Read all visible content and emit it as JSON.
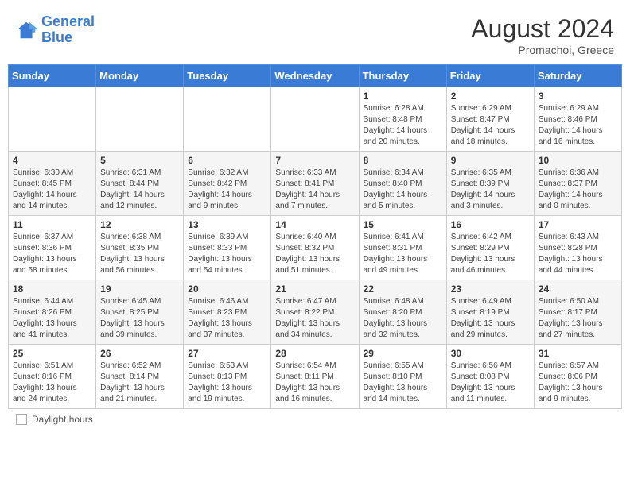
{
  "header": {
    "logo_line1": "General",
    "logo_line2": "Blue",
    "month_year": "August 2024",
    "location": "Promachoi, Greece"
  },
  "columns": [
    "Sunday",
    "Monday",
    "Tuesday",
    "Wednesday",
    "Thursday",
    "Friday",
    "Saturday"
  ],
  "legend": {
    "label": "Daylight hours"
  },
  "weeks": [
    [
      {
        "day": "",
        "info": ""
      },
      {
        "day": "",
        "info": ""
      },
      {
        "day": "",
        "info": ""
      },
      {
        "day": "",
        "info": ""
      },
      {
        "day": "1",
        "info": "Sunrise: 6:28 AM\nSunset: 8:48 PM\nDaylight: 14 hours and 20 minutes."
      },
      {
        "day": "2",
        "info": "Sunrise: 6:29 AM\nSunset: 8:47 PM\nDaylight: 14 hours and 18 minutes."
      },
      {
        "day": "3",
        "info": "Sunrise: 6:29 AM\nSunset: 8:46 PM\nDaylight: 14 hours and 16 minutes."
      }
    ],
    [
      {
        "day": "4",
        "info": "Sunrise: 6:30 AM\nSunset: 8:45 PM\nDaylight: 14 hours and 14 minutes."
      },
      {
        "day": "5",
        "info": "Sunrise: 6:31 AM\nSunset: 8:44 PM\nDaylight: 14 hours and 12 minutes."
      },
      {
        "day": "6",
        "info": "Sunrise: 6:32 AM\nSunset: 8:42 PM\nDaylight: 14 hours and 9 minutes."
      },
      {
        "day": "7",
        "info": "Sunrise: 6:33 AM\nSunset: 8:41 PM\nDaylight: 14 hours and 7 minutes."
      },
      {
        "day": "8",
        "info": "Sunrise: 6:34 AM\nSunset: 8:40 PM\nDaylight: 14 hours and 5 minutes."
      },
      {
        "day": "9",
        "info": "Sunrise: 6:35 AM\nSunset: 8:39 PM\nDaylight: 14 hours and 3 minutes."
      },
      {
        "day": "10",
        "info": "Sunrise: 6:36 AM\nSunset: 8:37 PM\nDaylight: 14 hours and 0 minutes."
      }
    ],
    [
      {
        "day": "11",
        "info": "Sunrise: 6:37 AM\nSunset: 8:36 PM\nDaylight: 13 hours and 58 minutes."
      },
      {
        "day": "12",
        "info": "Sunrise: 6:38 AM\nSunset: 8:35 PM\nDaylight: 13 hours and 56 minutes."
      },
      {
        "day": "13",
        "info": "Sunrise: 6:39 AM\nSunset: 8:33 PM\nDaylight: 13 hours and 54 minutes."
      },
      {
        "day": "14",
        "info": "Sunrise: 6:40 AM\nSunset: 8:32 PM\nDaylight: 13 hours and 51 minutes."
      },
      {
        "day": "15",
        "info": "Sunrise: 6:41 AM\nSunset: 8:31 PM\nDaylight: 13 hours and 49 minutes."
      },
      {
        "day": "16",
        "info": "Sunrise: 6:42 AM\nSunset: 8:29 PM\nDaylight: 13 hours and 46 minutes."
      },
      {
        "day": "17",
        "info": "Sunrise: 6:43 AM\nSunset: 8:28 PM\nDaylight: 13 hours and 44 minutes."
      }
    ],
    [
      {
        "day": "18",
        "info": "Sunrise: 6:44 AM\nSunset: 8:26 PM\nDaylight: 13 hours and 41 minutes."
      },
      {
        "day": "19",
        "info": "Sunrise: 6:45 AM\nSunset: 8:25 PM\nDaylight: 13 hours and 39 minutes."
      },
      {
        "day": "20",
        "info": "Sunrise: 6:46 AM\nSunset: 8:23 PM\nDaylight: 13 hours and 37 minutes."
      },
      {
        "day": "21",
        "info": "Sunrise: 6:47 AM\nSunset: 8:22 PM\nDaylight: 13 hours and 34 minutes."
      },
      {
        "day": "22",
        "info": "Sunrise: 6:48 AM\nSunset: 8:20 PM\nDaylight: 13 hours and 32 minutes."
      },
      {
        "day": "23",
        "info": "Sunrise: 6:49 AM\nSunset: 8:19 PM\nDaylight: 13 hours and 29 minutes."
      },
      {
        "day": "24",
        "info": "Sunrise: 6:50 AM\nSunset: 8:17 PM\nDaylight: 13 hours and 27 minutes."
      }
    ],
    [
      {
        "day": "25",
        "info": "Sunrise: 6:51 AM\nSunset: 8:16 PM\nDaylight: 13 hours and 24 minutes."
      },
      {
        "day": "26",
        "info": "Sunrise: 6:52 AM\nSunset: 8:14 PM\nDaylight: 13 hours and 21 minutes."
      },
      {
        "day": "27",
        "info": "Sunrise: 6:53 AM\nSunset: 8:13 PM\nDaylight: 13 hours and 19 minutes."
      },
      {
        "day": "28",
        "info": "Sunrise: 6:54 AM\nSunset: 8:11 PM\nDaylight: 13 hours and 16 minutes."
      },
      {
        "day": "29",
        "info": "Sunrise: 6:55 AM\nSunset: 8:10 PM\nDaylight: 13 hours and 14 minutes."
      },
      {
        "day": "30",
        "info": "Sunrise: 6:56 AM\nSunset: 8:08 PM\nDaylight: 13 hours and 11 minutes."
      },
      {
        "day": "31",
        "info": "Sunrise: 6:57 AM\nSunset: 8:06 PM\nDaylight: 13 hours and 9 minutes."
      }
    ]
  ]
}
